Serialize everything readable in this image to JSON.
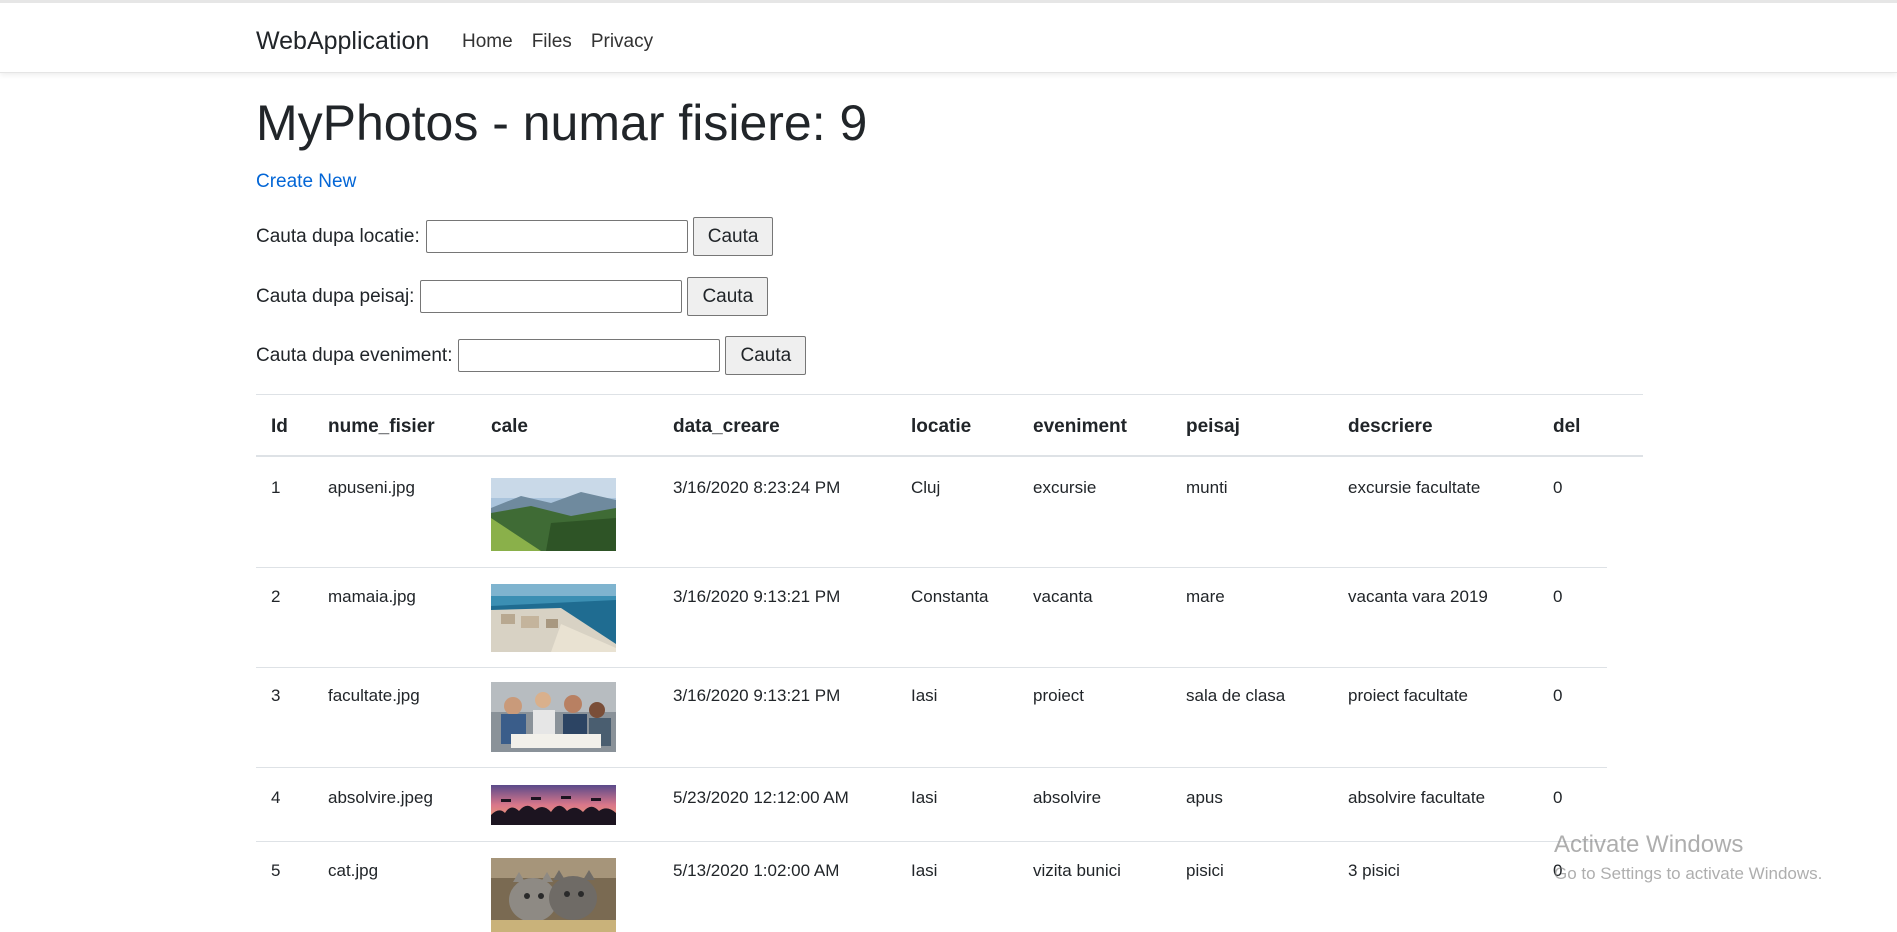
{
  "navbar": {
    "brand": "WebApplication",
    "links": [
      "Home",
      "Files",
      "Privacy"
    ]
  },
  "page": {
    "title": "MyPhotos - numar fisiere: 9",
    "create_link": "Create New"
  },
  "search": [
    {
      "label": "Cauta dupa locatie:",
      "value": "",
      "button": "Cauta"
    },
    {
      "label": "Cauta dupa peisaj:",
      "value": "",
      "button": "Cauta"
    },
    {
      "label": "Cauta dupa eveniment:",
      "value": "",
      "button": "Cauta"
    }
  ],
  "table": {
    "columns": [
      "Id",
      "nume_fisier",
      "cale",
      "data_creare",
      "locatie",
      "eveniment",
      "peisaj",
      "descriere",
      "del"
    ],
    "rows": [
      {
        "id": "1",
        "nume_fisier": "apuseni.jpg",
        "cale": "mountain-landscape-photo",
        "data_creare": "3/16/2020 8:23:24 PM",
        "locatie": "Cluj",
        "eveniment": "excursie",
        "peisaj": "munti",
        "descriere": "excursie facultate",
        "del": "0"
      },
      {
        "id": "2",
        "nume_fisier": "mamaia.jpg",
        "cale": "beach-resort-photo",
        "data_creare": "3/16/2020 9:13:21 PM",
        "locatie": "Constanta",
        "eveniment": "vacanta",
        "peisaj": "mare",
        "descriere": "vacanta vara 2019",
        "del": "0"
      },
      {
        "id": "3",
        "nume_fisier": "facultate.jpg",
        "cale": "students-studying-photo",
        "data_creare": "3/16/2020 9:13:21 PM",
        "locatie": "Iasi",
        "eveniment": "proiect",
        "peisaj": "sala de clasa",
        "descriere": "proiect facultate",
        "del": "0"
      },
      {
        "id": "4",
        "nume_fisier": "absolvire.jpeg",
        "cale": "graduation-sunset-photo",
        "data_creare": "5/23/2020 12:12:00 AM",
        "locatie": "Iasi",
        "eveniment": "absolvire",
        "peisaj": "apus",
        "descriere": "absolvire facultate",
        "del": "0"
      },
      {
        "id": "5",
        "nume_fisier": "cat.jpg",
        "cale": "kittens-photo",
        "data_creare": "5/13/2020 1:02:00 AM",
        "locatie": "Iasi",
        "eveniment": "vizita bunici",
        "peisaj": "pisici",
        "descriere": "3 pisici",
        "del": "0"
      }
    ]
  },
  "watermark": {
    "line1": "Activate Windows",
    "line2": "Go to Settings to activate Windows."
  },
  "colors": {
    "link": "#0366d6",
    "text": "#212529",
    "border": "#dee2e6"
  }
}
